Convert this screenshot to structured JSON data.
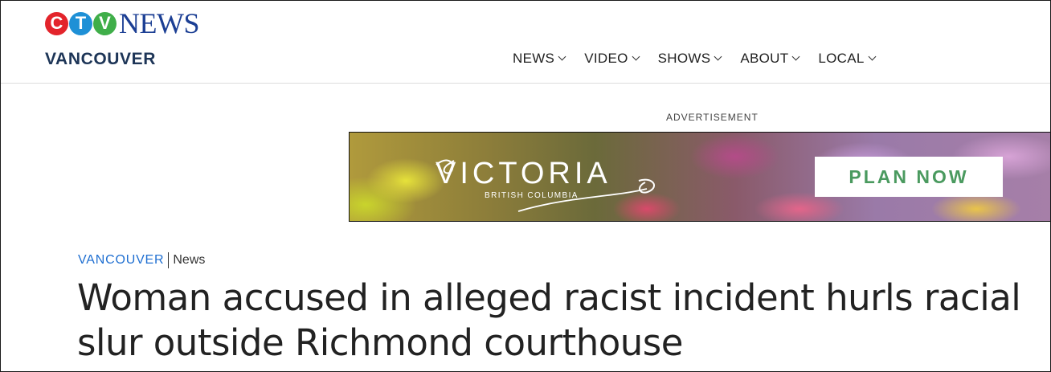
{
  "header": {
    "logo": {
      "letters": [
        "C",
        "T",
        "V"
      ],
      "wordmark": "NEWS"
    },
    "region": "VANCOUVER",
    "nav": [
      {
        "label": "NEWS"
      },
      {
        "label": "VIDEO"
      },
      {
        "label": "SHOWS"
      },
      {
        "label": "ABOUT"
      },
      {
        "label": "LOCAL"
      }
    ]
  },
  "ad": {
    "label": "ADVERTISEMENT",
    "brand": "VICTORIA",
    "subtitle": "BRITISH COLUMBIA",
    "cta": "PLAN NOW"
  },
  "article": {
    "breadcrumb_region": "VANCOUVER",
    "breadcrumb_section": "News",
    "headline": "Woman accused in alleged racist incident hurls racial slur outside Richmond courthouse"
  },
  "colors": {
    "brand_blue": "#1c3f94",
    "logo_red": "#e3242b",
    "logo_blue": "#1e90d6",
    "logo_green": "#3fae49",
    "link_blue": "#1f6fd1",
    "cta_green": "#4a9a5f"
  },
  "icons": {
    "nav_dropdown": "chevron-down-icon"
  }
}
